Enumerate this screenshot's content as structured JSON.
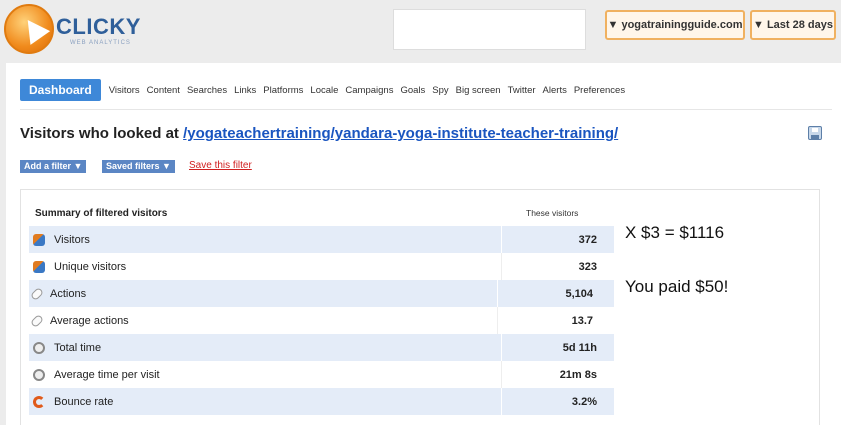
{
  "brand": {
    "name": "CLICKY",
    "tagline": "WEB ANALYTICS"
  },
  "header": {
    "site_selector": "▼ yogatrainingguide.com",
    "date_range": "▼ Last 28 days"
  },
  "nav": {
    "active": "Dashboard",
    "items": [
      "Visitors",
      "Content",
      "Searches",
      "Links",
      "Platforms",
      "Locale",
      "Campaigns",
      "Goals",
      "Spy",
      "Big screen",
      "Twitter",
      "Alerts",
      "Preferences"
    ]
  },
  "page": {
    "title_prefix": "Visitors who looked at ",
    "title_link": "/yogateachertraining/yandara-yoga-institute-teacher-training/"
  },
  "filters": {
    "add": "Add a filter ▼",
    "saved": "Saved filters ▼",
    "save": "Save this filter"
  },
  "summary": {
    "header": "Summary of filtered visitors",
    "column": "These visitors",
    "rows": [
      {
        "label": "Visitors",
        "value": "372",
        "icon": "people-icon"
      },
      {
        "label": "Unique visitors",
        "value": "323",
        "icon": "people-icon"
      },
      {
        "label": "Actions",
        "value": "5,104",
        "icon": "mouse-icon"
      },
      {
        "label": "Average actions",
        "value": "13.7",
        "icon": "mouse-icon"
      },
      {
        "label": "Total time",
        "value": "5d 11h",
        "icon": "clock-icon"
      },
      {
        "label": "Average time per visit",
        "value": "21m 8s",
        "icon": "clock-icon"
      },
      {
        "label": "Bounce rate",
        "value": "3.2%",
        "icon": "bounce-icon"
      }
    ]
  },
  "annotations": {
    "multiply": "X $3 = $1116",
    "paid": "You paid $50!"
  },
  "colors": {
    "accent": "#3e88d8",
    "link": "#1a55c0",
    "row_shade": "#e4ecf8",
    "logo_orange": "#f08a1c"
  }
}
